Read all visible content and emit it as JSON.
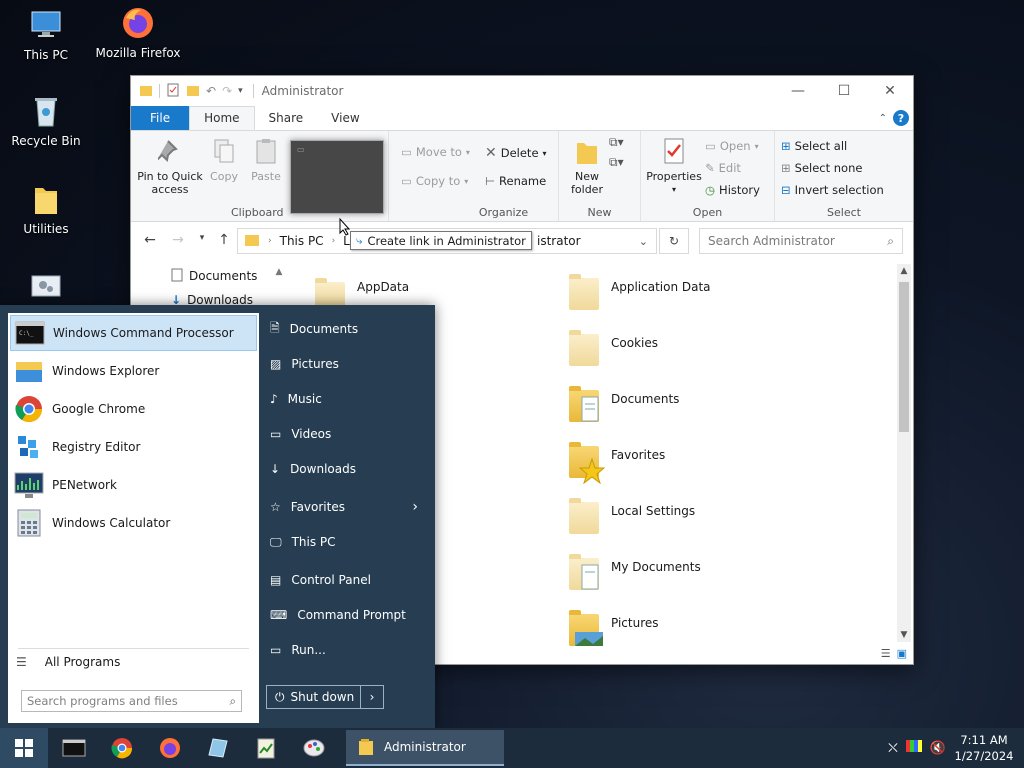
{
  "desktop": {
    "icons": [
      {
        "label": "This PC"
      },
      {
        "label": "Mozilla Firefox"
      },
      {
        "label": "Recycle Bin"
      },
      {
        "label": "Utilities"
      }
    ]
  },
  "explorer": {
    "title": "Administrator",
    "tabs": {
      "file": "File",
      "home": "Home",
      "share": "Share",
      "view": "View"
    },
    "help": "?",
    "ribbon": {
      "clipboard": {
        "pin_label": "Pin to Quick access",
        "copy_label": "Copy",
        "paste_label": "Paste",
        "group_label": "Clipboard"
      },
      "organize": {
        "move_to": "Move to",
        "copy_to": "Copy to",
        "delete": "Delete",
        "rename": "Rename",
        "group_label": "Organize"
      },
      "new": {
        "new_folder": "New folder",
        "group_label": "New"
      },
      "open": {
        "properties": "Properties",
        "open": "Open",
        "edit": "Edit",
        "history": "History",
        "group_label": "Open"
      },
      "select": {
        "select_all": "Select all",
        "select_none": "Select none",
        "invert_selection": "Invert selection",
        "group_label": "Select"
      }
    },
    "address": {
      "segment1": "This PC",
      "segment2_partial": "Lo",
      "segment3_partial": "istrator"
    },
    "search_placeholder": "Search Administrator",
    "nav_pane": [
      {
        "label": "Documents"
      },
      {
        "label": "Downloads"
      }
    ],
    "items_left": [
      {
        "label": "AppData"
      }
    ],
    "items_right": [
      {
        "label": "Application Data"
      },
      {
        "label": "Cookies"
      },
      {
        "label": "Documents"
      },
      {
        "label": "Favorites"
      },
      {
        "label": "Local Settings"
      },
      {
        "label": "My Documents"
      },
      {
        "label": "Pictures"
      }
    ],
    "tooltip": "Create link in Administrator"
  },
  "start_menu": {
    "programs": [
      {
        "label": "Windows Command Processor"
      },
      {
        "label": "Windows Explorer"
      },
      {
        "label": "Google Chrome"
      },
      {
        "label": "Registry Editor"
      },
      {
        "label": "PENetwork"
      },
      {
        "label": "Windows Calculator"
      }
    ],
    "all_programs": "All Programs",
    "search_placeholder": "Search programs and files",
    "right_items": [
      {
        "label": "Documents"
      },
      {
        "label": "Pictures"
      },
      {
        "label": "Music"
      },
      {
        "label": "Videos"
      },
      {
        "label": "Downloads"
      },
      {
        "label": "Favorites"
      },
      {
        "label": "This PC"
      },
      {
        "label": "Control Panel"
      },
      {
        "label": "Command Prompt"
      },
      {
        "label": "Run..."
      }
    ],
    "shutdown": "Shut down"
  },
  "taskbar": {
    "window_label": "Administrator",
    "time": "7:11 AM",
    "date": "1/27/2024"
  }
}
